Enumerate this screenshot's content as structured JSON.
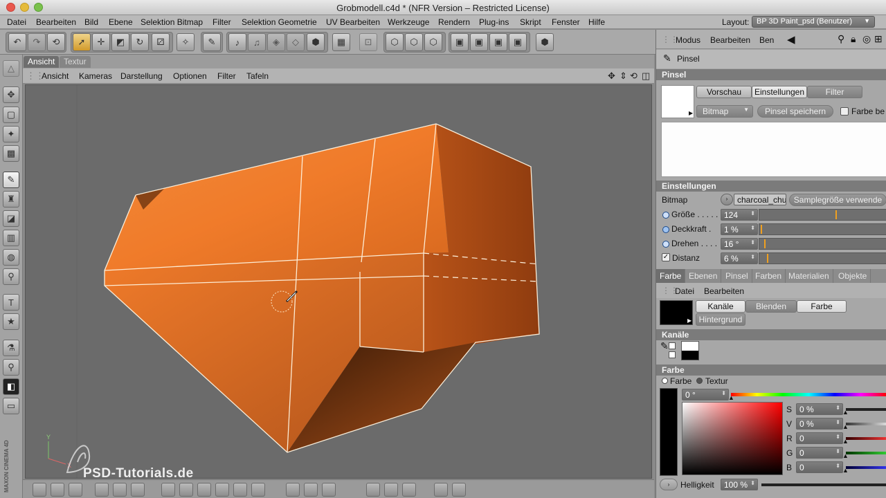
{
  "window": {
    "title": "Grobmodell.c4d * (NFR Version – Restricted License)"
  },
  "menubar": {
    "items": [
      "Datei",
      "Bearbeiten",
      "Bild",
      "Ebene",
      "Selektion Bitmap",
      "Filter",
      "Selektion Geometrie",
      "UV Bearbeiten",
      "Werkzeuge",
      "Rendern",
      "Plug-ins",
      "Skript",
      "Fenster",
      "Hilfe"
    ],
    "layout_label": "Layout:",
    "layout_value": "BP 3D Paint_psd (Benutzer)"
  },
  "viewport": {
    "tabs": [
      "Ansicht",
      "Textur"
    ],
    "active_tab": "Ansicht",
    "menu": [
      "Ansicht",
      "Kameras",
      "Darstellung",
      "Optionen",
      "Filter",
      "Tafeln"
    ],
    "axis_y": "Y",
    "axis_x": "X"
  },
  "watermark": "PSD-Tutorials.de",
  "maxon_label": "MAXON CINEMA 4D",
  "attributes": {
    "menu": [
      "Modus",
      "Bearbeiten",
      "Ben"
    ],
    "tool_name": "Pinsel",
    "section_title": "Pinsel",
    "brush_tabs": [
      "Vorschau",
      "Einstellungen",
      "Filter"
    ],
    "bitmap_dropdown": "Bitmap",
    "save_brush_button": "Pinsel speichern",
    "color_checkbox_label": "Farbe be",
    "settings_title": "Einstellungen",
    "bitmap_label": "Bitmap",
    "bitmap_value": "charcoal_chur",
    "sample_button": "Samplegröße verwende",
    "params": [
      {
        "label": "Größe",
        "dots": " . . . . .",
        "value": "124",
        "level": 0.6
      },
      {
        "label": "Deckkraft",
        "dots": " .",
        "value": "1 %",
        "level": 0.01
      },
      {
        "label": "Drehen",
        "dots": " . . . .",
        "value": "16 °",
        "level": 0.04
      },
      {
        "label": "Distanz",
        "dots": "",
        "value": "6 %",
        "level": 0.06
      }
    ]
  },
  "lower_tabs": [
    "Farbe",
    "Ebenen",
    "Pinsel",
    "Farben",
    "Materialien",
    "Objekte"
  ],
  "lower_active_tab": "Farbe",
  "lower_menu": [
    "Datei",
    "Bearbeiten"
  ],
  "color_tabs": [
    "Kanäle",
    "Blenden",
    "Farbe"
  ],
  "background_button": "Hintergrund",
  "channels_title": "Kanäle",
  "color_title": "Farbe",
  "color_mode": {
    "option_1": "Farbe",
    "option_2": "Textur"
  },
  "hue_value": "0 °",
  "color_params": [
    {
      "label": "S",
      "value": "0 %"
    },
    {
      "label": "V",
      "value": "0 %"
    },
    {
      "label": "R",
      "value": "0"
    },
    {
      "label": "G",
      "value": "0"
    },
    {
      "label": "B",
      "value": "0"
    }
  ],
  "brightness_label": "Helligkeit",
  "brightness_value": "100 %",
  "colors": {
    "model_orange": "#f07b2a",
    "model_dark": "#9a3f10",
    "viewport_bg": "#6b6b6b",
    "accent": "#f0a020"
  }
}
